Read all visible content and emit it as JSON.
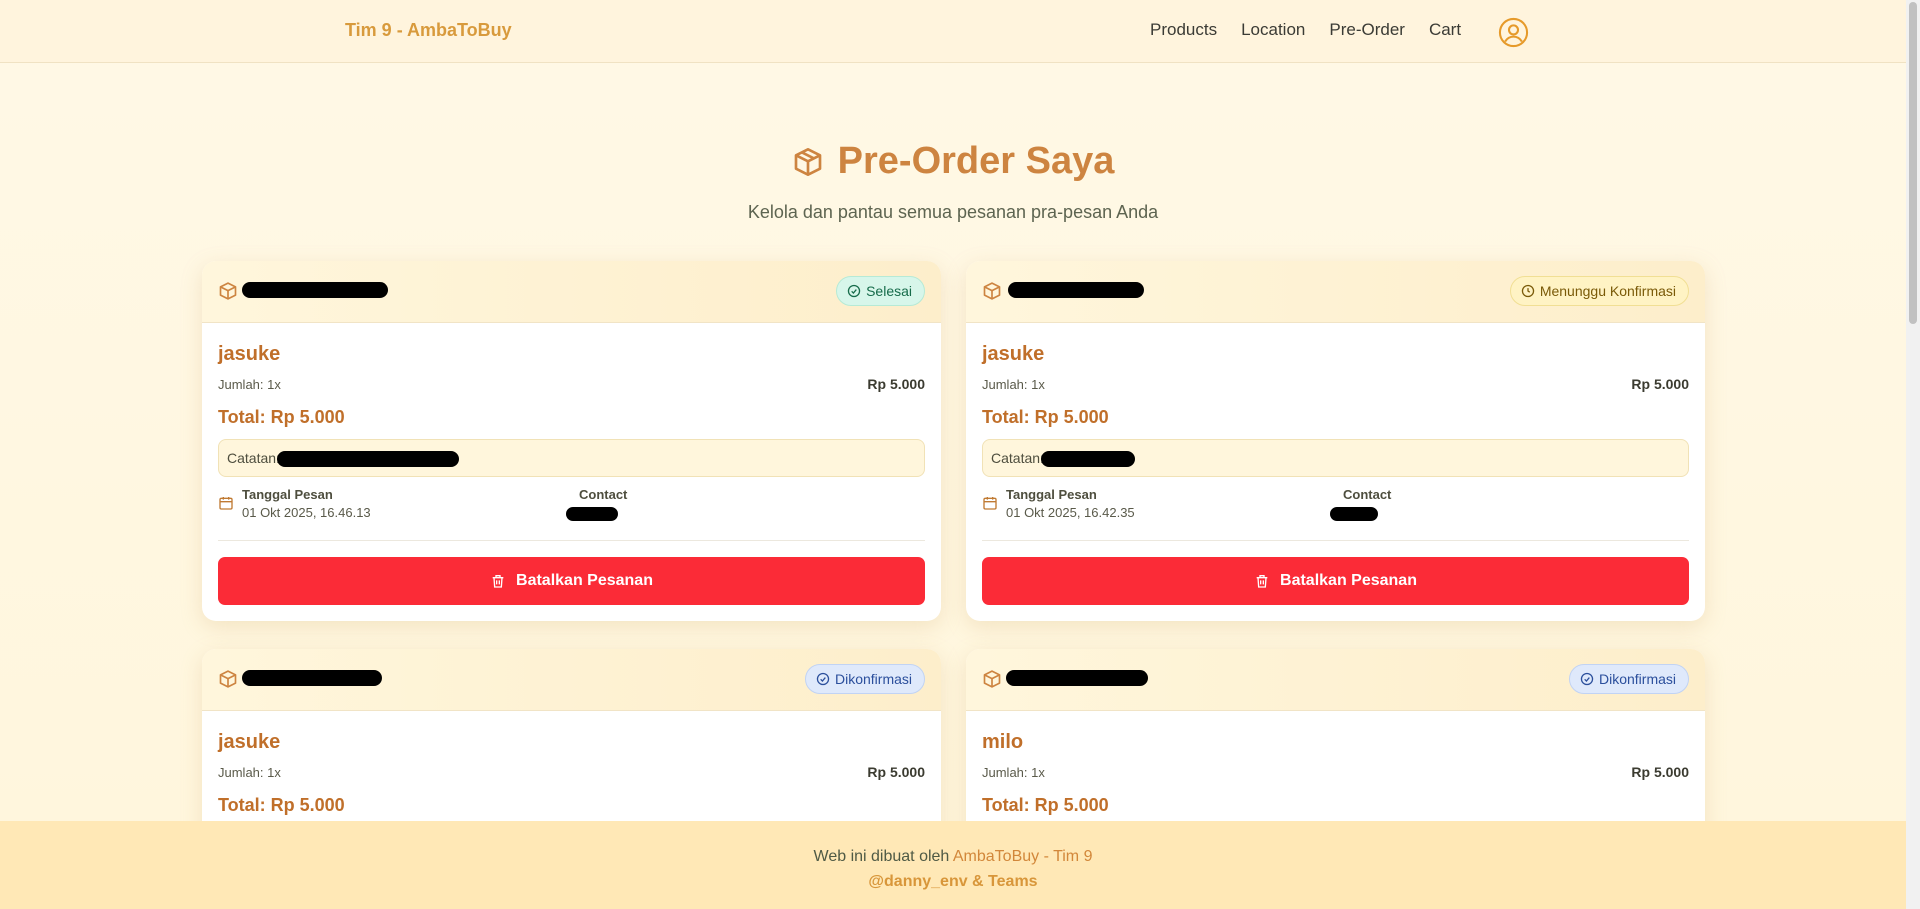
{
  "navbar": {
    "brand": "Tim 9 - AmbaToBuy",
    "links": [
      "Products",
      "Location",
      "Pre-Order",
      "Cart"
    ],
    "profile_icon": "user-circle-icon"
  },
  "header": {
    "title": "Pre-Order Saya",
    "subtitle": "Kelola dan pantau semua pesanan pra-pesan Anda",
    "icon": "package-icon"
  },
  "orders": [
    {
      "status": "Selesai",
      "product": "jasuke",
      "qty": "Jumlah: 1x",
      "price": "Rp 5.000",
      "total": "Total: Rp 5.000",
      "note_label": "Catatan:",
      "date_label": "Tanggal Pesan",
      "date_value": "01 Okt 2025, 16.46.13",
      "contact_label": "Contact",
      "cancel_label": "Batalkan Pesanan"
    },
    {
      "status": "Menunggu Konfirmasi",
      "product": "jasuke",
      "qty": "Jumlah: 1x",
      "price": "Rp 5.000",
      "total": "Total: Rp 5.000",
      "note_label": "Catatan:",
      "date_label": "Tanggal Pesan",
      "date_value": "01 Okt 2025, 16.42.35",
      "contact_label": "Contact",
      "cancel_label": "Batalkan Pesanan"
    },
    {
      "status": "Dikonfirmasi",
      "product": "jasuke",
      "qty": "Jumlah: 1x",
      "price": "Rp 5.000",
      "total": "Total: Rp 5.000"
    },
    {
      "status": "Dikonfirmasi",
      "product": "milo",
      "qty": "Jumlah: 1x",
      "price": "Rp 5.000",
      "total": "Total: Rp 5.000"
    }
  ],
  "colors": {
    "accent": "#cd8440",
    "danger": "#fb2b37",
    "status_done": "#d7f6ea",
    "status_wait": "#fff3c4",
    "status_confirmed": "#dfe9fb"
  },
  "footer": {
    "line1_prefix": "Web ini dibuat oleh ",
    "line1_brand": "AmbaToBuy - Tim 9",
    "line2": "@danny_env & Teams"
  }
}
